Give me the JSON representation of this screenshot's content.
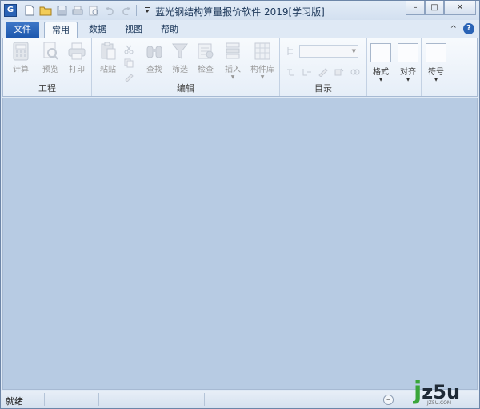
{
  "window": {
    "title": "蓝光钢结构算量报价软件 2019[学习版]",
    "app_icon_letter": "G"
  },
  "quick_access": [
    "new-doc-icon",
    "open-folder-icon",
    "save-icon",
    "print-icon",
    "print-preview-icon",
    "undo-icon",
    "redo-icon",
    "customize-icon"
  ],
  "window_controls": {
    "minimize": "–",
    "maximize": "□",
    "close": "✕"
  },
  "tabs": {
    "file": "文件",
    "items": [
      {
        "label": "常用",
        "active": true
      },
      {
        "label": "数据",
        "active": false
      },
      {
        "label": "视图",
        "active": false
      },
      {
        "label": "帮助",
        "active": false
      }
    ],
    "collapse": "^",
    "help": "?"
  },
  "ribbon": {
    "groups": {
      "project": {
        "label": "工程",
        "buttons": [
          "计算",
          "预览",
          "打印"
        ]
      },
      "edit": {
        "label": "编辑",
        "buttons": [
          "粘贴",
          "查找",
          "筛选",
          "检查",
          "插入",
          "构件库"
        ]
      },
      "catalog": {
        "label": "目录"
      },
      "format": {
        "label": "格式"
      },
      "align": {
        "label": "对齐"
      },
      "symbol": {
        "label": "符号"
      }
    }
  },
  "statusbar": {
    "text": "就绪",
    "zoom_out": "–"
  },
  "watermark": {
    "logo": "jz5u",
    "sub": "JZ5U.COM"
  },
  "colors": {
    "accent": "#2a63b5",
    "content_bg": "#b7cbe3",
    "ribbon_bg": "#f7fafd"
  }
}
